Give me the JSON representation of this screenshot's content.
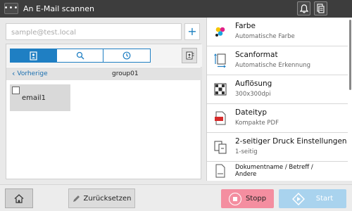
{
  "header": {
    "title": "An E-Mail scannen"
  },
  "address": {
    "placeholder": "sample@test.local",
    "add_label": "+"
  },
  "nav": {
    "back_label": "Vorherige",
    "group_label": "group01"
  },
  "entries": [
    {
      "label": "email1",
      "checked": false
    }
  ],
  "settings": [
    {
      "title": "Farbe",
      "value": "Automatische Farbe",
      "icon": "color-icon"
    },
    {
      "title": "Scanformat",
      "value": "Automatische Erkennung",
      "icon": "scan-size-icon"
    },
    {
      "title": "Auflösung",
      "value": "300x300dpi",
      "icon": "resolution-icon"
    },
    {
      "title": "Dateityp",
      "value": "Kompakte PDF",
      "icon": "pdf-file-icon"
    },
    {
      "title": "2-seitiger Druck Einstellungen",
      "value": "1-seitig",
      "icon": "duplex-icon"
    },
    {
      "title": "Dokumentname / Betreff /",
      "value": "Andere",
      "icon": "document-icon"
    }
  ],
  "footer": {
    "reset_label": "Zurücksetzen",
    "stop_label": "Stopp",
    "start_label": "Start"
  },
  "colors": {
    "accent": "#1f7fc3",
    "stop": "#f48ea0",
    "start": "#a9d3ee",
    "header_bg": "#3d3d3d"
  }
}
